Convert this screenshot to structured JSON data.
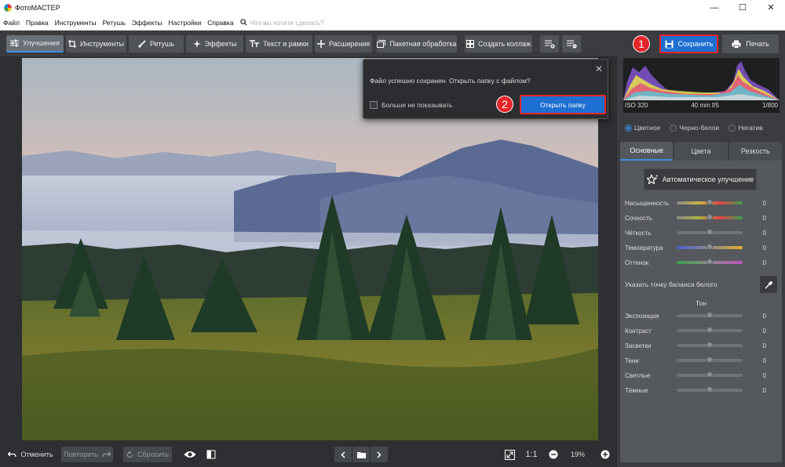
{
  "window": {
    "title": "ФотоМАСТЕР",
    "minimize": "—",
    "maximize": "☐",
    "close": "✕"
  },
  "menu": {
    "items": [
      "Файл",
      "Правка",
      "Инструменты",
      "Ретушь",
      "Эффекты",
      "Настройки",
      "Справка"
    ],
    "search_placeholder": "Что вы хотите сделать?"
  },
  "toolbar": {
    "tabs": [
      {
        "label": "Улучшения",
        "icon": "sliders-icon"
      },
      {
        "label": "Инструменты",
        "icon": "crop-icon"
      },
      {
        "label": "Ретушь",
        "icon": "brush-icon"
      },
      {
        "label": "Эффекты",
        "icon": "sparkle-icon"
      },
      {
        "label": "Текст и рамки",
        "icon": "text-icon"
      },
      {
        "label": "Расширения",
        "icon": "plus-icon"
      }
    ],
    "batch_label": "Пакетная обработка",
    "collage_label": "Создать коллаж",
    "save_label": "Сохранить",
    "print_label": "Печать"
  },
  "badges": {
    "one": "1",
    "two": "2"
  },
  "dialog": {
    "message": "Файл успешно сохранен. Открыть папку с файлом?",
    "checkbox_label": "Больше не показывать",
    "open_button": "Открыть папку",
    "close": "✕"
  },
  "bottombar": {
    "undo_label": "Отменить",
    "redo_label": "Повторить",
    "reset_label": "Сбросить",
    "ratio_label": "1:1",
    "zoom_value": "19%"
  },
  "panel": {
    "exif": {
      "iso": "ISO 320",
      "lens": "40 mm f/5",
      "shutter": "1/800"
    },
    "modes": [
      {
        "label": "Цветное",
        "selected": true
      },
      {
        "label": "Черно-белое",
        "selected": false
      },
      {
        "label": "Негатив",
        "selected": false
      }
    ],
    "tabs": [
      "Основные",
      "Цвета",
      "Резкость"
    ],
    "auto_button": "Автоматическое улучшение",
    "sliders": [
      {
        "label": "Насыщенность",
        "value": "0"
      },
      {
        "label": "Сочность",
        "value": "0"
      },
      {
        "label": "Чёткость",
        "value": "0"
      },
      {
        "label": "Температура",
        "value": "0"
      },
      {
        "label": "Оттенок",
        "value": "0"
      }
    ],
    "white_balance_label": "Указать точку баланса белого",
    "tone_heading": "Тон",
    "tone_sliders": [
      {
        "label": "Экспозиция",
        "value": "0"
      },
      {
        "label": "Контраст",
        "value": "0"
      },
      {
        "label": "Засветки",
        "value": "0"
      },
      {
        "label": "Тени",
        "value": "0"
      },
      {
        "label": "Светлые",
        "value": "0"
      },
      {
        "label": "Тёмные",
        "value": "0"
      }
    ]
  }
}
